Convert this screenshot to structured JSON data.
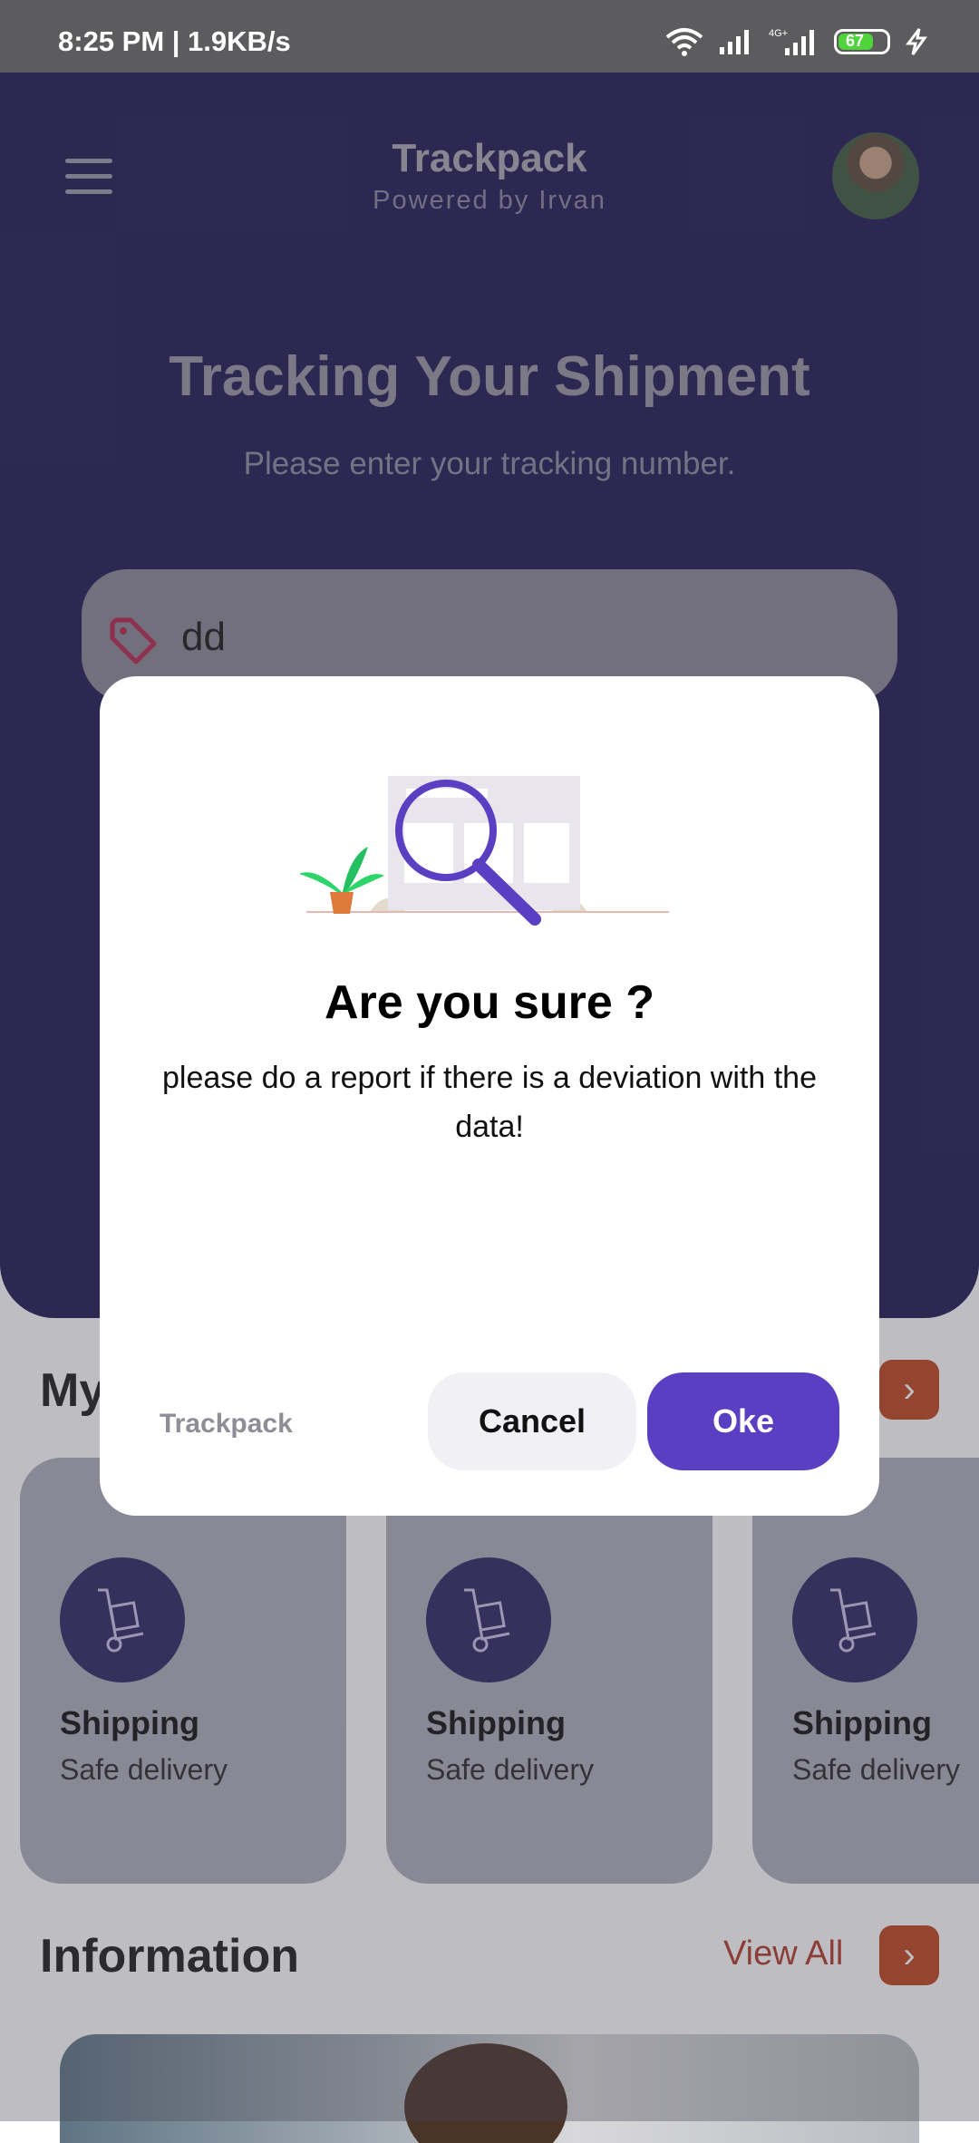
{
  "status_bar": {
    "time": "8:25 PM | 1.9KB/s",
    "icons": [
      "wifi-icon",
      "signal-icon",
      "signal-4g-icon",
      "battery-icon",
      "charging-icon"
    ],
    "battery": "67"
  },
  "header": {
    "title": "Trackpack",
    "subtitle": "Powered by Irvan",
    "menu_icon": "menu-icon",
    "avatar": "user-avatar"
  },
  "hero": {
    "title": "Tracking Your Shipment",
    "subtitle": "Please enter your tracking number.",
    "search_value": "dd",
    "search_icon": "tag-icon"
  },
  "my_section": {
    "title": "My"
  },
  "cards": [
    {
      "title": "Shipping",
      "subtitle": "Safe delivery",
      "icon": "hand-truck-icon"
    },
    {
      "title": "Shipping",
      "subtitle": "Safe delivery",
      "icon": "hand-truck-icon"
    },
    {
      "title": "Shipping",
      "subtitle": "Safe delivery",
      "icon": "hand-truck-icon"
    }
  ],
  "information": {
    "title": "Information",
    "view_all": "View All"
  },
  "dialog": {
    "title": "Are you sure ?",
    "message": "please do a report if there is a deviation with the data!",
    "brand": "Trackpack",
    "cancel_label": "Cancel",
    "ok_label": "Oke"
  },
  "colors": {
    "hero_bg": "#1f1a54",
    "accent": "#5a3fc2",
    "arrow_btn": "#c0441f",
    "view_all": "#b43a2a"
  }
}
